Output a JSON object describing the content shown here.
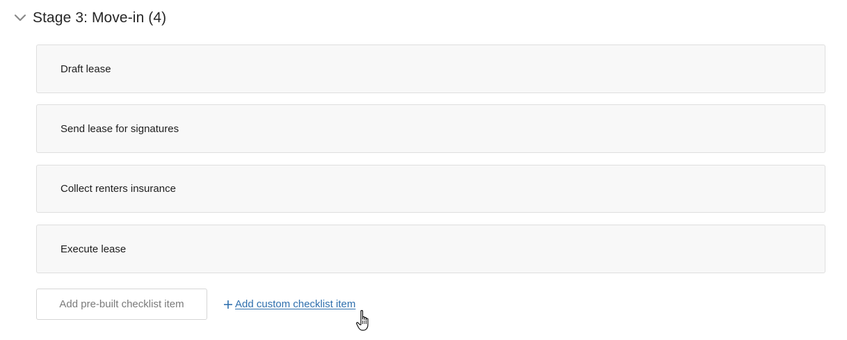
{
  "stage": {
    "title": "Stage 3: Move-in (4)",
    "chevron_icon": "chevron-down-icon"
  },
  "checklist": {
    "items": [
      {
        "label": "Draft lease"
      },
      {
        "label": "Send lease for signatures"
      },
      {
        "label": "Collect renters insurance"
      },
      {
        "label": "Execute lease"
      }
    ]
  },
  "actions": {
    "prebuilt_label": "Add pre-built checklist item",
    "custom_label": "Add custom checklist item",
    "custom_icon": "plus-icon"
  },
  "colors": {
    "link": "#2f6fad",
    "item_bg": "#f8f8f8",
    "item_border": "#dedede"
  },
  "pointer": {
    "icon": "hand-pointer-icon"
  }
}
